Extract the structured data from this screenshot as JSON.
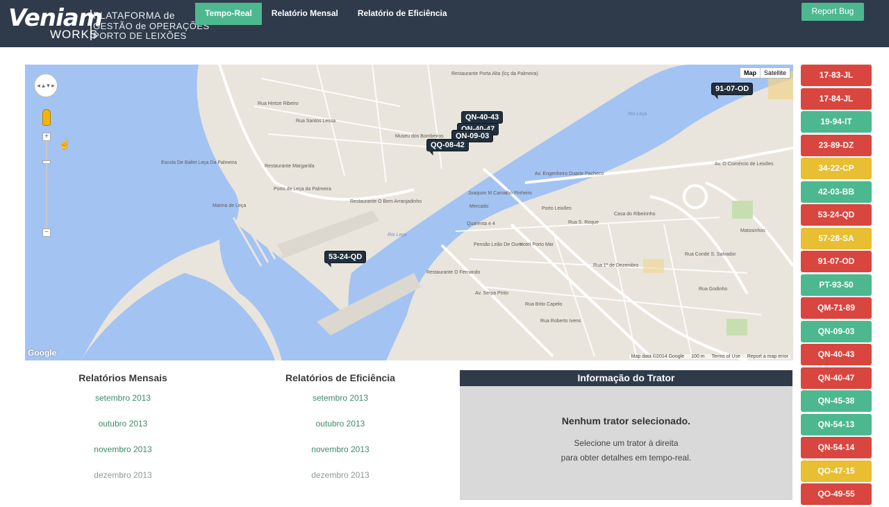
{
  "header": {
    "logo": {
      "brand": "Veniam",
      "sub": "WORKS",
      "line1": "PLATAFORMA de",
      "line2": "GESTÃO de OPERAÇÕES",
      "line3": "PORTO DE LEIXÕES"
    },
    "tabs": [
      {
        "label": "Tempo-Real",
        "active": true
      },
      {
        "label": "Relatório Mensal",
        "active": false
      },
      {
        "label": "Relatório de Eficiência",
        "active": false
      }
    ],
    "report_bug": "Report Bug"
  },
  "map": {
    "type_options": [
      "Map",
      "Satellite"
    ],
    "markers": [
      {
        "label": "91-07-OD"
      },
      {
        "label": "53-24-QD"
      },
      {
        "label": "QQ-08-42"
      },
      {
        "label": "QN-09-03"
      },
      {
        "label": "QN-40-43"
      },
      {
        "label": "QN-40-47"
      }
    ],
    "labels": [
      "Restaurante Porta Alta (lcç da Palmeira)",
      "Rua Hintze Ribeiro",
      "Rua Santos Lessa",
      "Museu dos Bombeiros",
      "Escola De Ballet Leça Da Palmeira",
      "Restaurante Margarida",
      "Porto de Leça da Palmeira",
      "Restaurante O Bem Arranjadinho",
      "Av. Engenheiro Duarte Pacheco",
      "Av. O Comércio de Leixões",
      "Joaquim M Carvalho Pinheiro",
      "Mercado",
      "Porto Leixões",
      "Casa do Ribeirinho",
      "Rua S. Roque",
      "Quarenta e 4",
      "Pensão Leão De Ouro",
      "Hotel Porto Mar",
      "Restaurante O Fernando",
      "Av. Serpa Pinto",
      "Rua Roberto Ivens",
      "Rua Brito Capelo",
      "Matosinhos",
      "Rua Godinho",
      "Rua Conde S. Salvador",
      "Marina de Leça",
      "Rua 1º de Dezembro"
    ],
    "water_labels": [
      "Rio Leça",
      "Rio Leça"
    ],
    "attribution": [
      "Map data ©2014 Google",
      "100 m",
      "Terms of Use",
      "Report a map error"
    ],
    "google": "Google"
  },
  "tratores": [
    {
      "label": "17-83-JL",
      "status": "red"
    },
    {
      "label": "17-84-JL",
      "status": "red"
    },
    {
      "label": "19-94-IT",
      "status": "green"
    },
    {
      "label": "23-89-DZ",
      "status": "red"
    },
    {
      "label": "34-22-CP",
      "status": "yellow"
    },
    {
      "label": "42-03-BB",
      "status": "green"
    },
    {
      "label": "53-24-QD",
      "status": "red"
    },
    {
      "label": "57-28-SA",
      "status": "yellow"
    },
    {
      "label": "91-07-OD",
      "status": "red"
    },
    {
      "label": "PT-93-50",
      "status": "green"
    },
    {
      "label": "QM-71-89",
      "status": "red"
    },
    {
      "label": "QN-09-03",
      "status": "green"
    },
    {
      "label": "QN-40-43",
      "status": "red"
    },
    {
      "label": "QN-40-47",
      "status": "red"
    },
    {
      "label": "QN-45-38",
      "status": "green"
    },
    {
      "label": "QN-54-13",
      "status": "green"
    },
    {
      "label": "QN-54-14",
      "status": "red"
    },
    {
      "label": "QO-47-15",
      "status": "yellow"
    },
    {
      "label": "QO-49-55",
      "status": "red"
    }
  ],
  "reports": {
    "mensais": {
      "title": "Relatórios Mensais",
      "items": [
        "setembro 2013",
        "outubro 2013",
        "novembro 2013",
        "dezembro 2013"
      ]
    },
    "eficiencia": {
      "title": "Relatórios de Eficiência",
      "items": [
        "setembro 2013",
        "outubro 2013",
        "novembro 2013",
        "dezembro 2013"
      ]
    }
  },
  "info": {
    "header": "Informação do Trator",
    "title": "Nenhum trator selecionado.",
    "line1": "Selecione um trator à direita",
    "line2": "para obter detalhes em tempo-real."
  },
  "colors": {
    "header_bg": "#2f3b4a",
    "accent_green": "#4db88f",
    "status_red": "#d9453f",
    "status_yellow": "#e8be32",
    "water": "#a3c3f2",
    "land": "#e9e5dc"
  }
}
